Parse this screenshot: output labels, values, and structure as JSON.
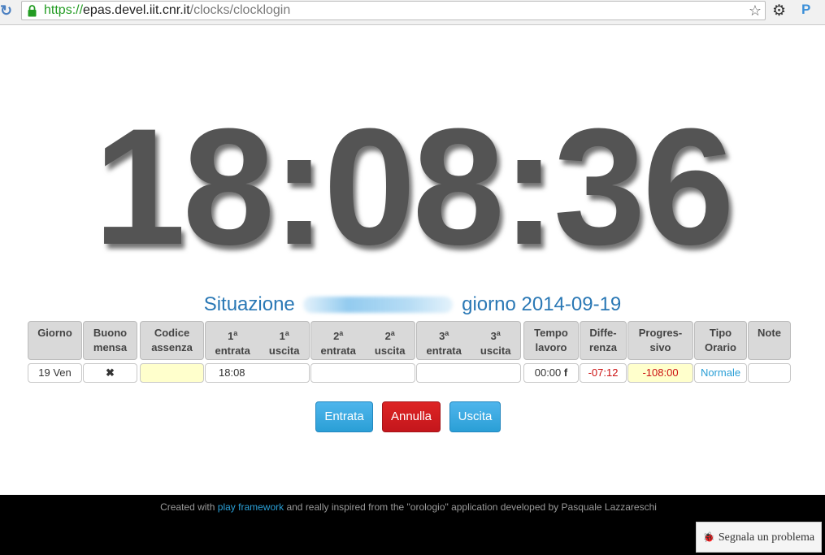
{
  "browser": {
    "url_scheme": "https://",
    "url_host": "epas.devel.iit.cnr.it",
    "url_path": "/clocks/clocklogin",
    "extension_label": "P"
  },
  "clock": {
    "time": "18:08:36"
  },
  "situation": {
    "prefix": "Situazione",
    "suffix": "giorno 2014-09-19"
  },
  "table": {
    "headers": {
      "giorno": [
        "Giorno"
      ],
      "buono": [
        "Buono",
        "mensa"
      ],
      "codice": [
        "Codice",
        "assenza"
      ],
      "pair1": {
        "n": "1",
        "sup": "a",
        "in": "entrata",
        "out": "uscita"
      },
      "pair2": {
        "n": "2",
        "sup": "a",
        "in": "entrata",
        "out": "uscita"
      },
      "pair3": {
        "n": "3",
        "sup": "a",
        "in": "entrata",
        "out": "uscita"
      },
      "tempo": [
        "Tempo",
        "lavoro"
      ],
      "differenza": [
        "Diffe-",
        "renza"
      ],
      "progressivo": [
        "Progres-",
        "sivo"
      ],
      "tipo": [
        "Tipo",
        "Orario"
      ],
      "note": [
        "Note"
      ]
    },
    "row": {
      "giorno": "19 Ven",
      "buono": "✖",
      "codice": "",
      "entrata1": "18:08",
      "pair2": "",
      "pair3": "",
      "tempo": "00:00",
      "tempo_flag": "f",
      "differenza": "-07:12",
      "progressivo": "-108:00",
      "tipo": "Normale",
      "note": ""
    }
  },
  "buttons": {
    "entrata": "Entrata",
    "annulla": "Annulla",
    "uscita": "Uscita"
  },
  "footer": {
    "before": "Created with ",
    "link": "play framework",
    "after": " and really inspired from the \"orologio\" application developed by Pasquale Lazzareschi"
  },
  "report": {
    "label": "Segnala un problema"
  },
  "colors": {
    "accent_blue": "#2a9fd6",
    "danger_red": "#c4161c",
    "highlight_yellow": "#ffffcc",
    "title_blue": "#2a78b5"
  }
}
